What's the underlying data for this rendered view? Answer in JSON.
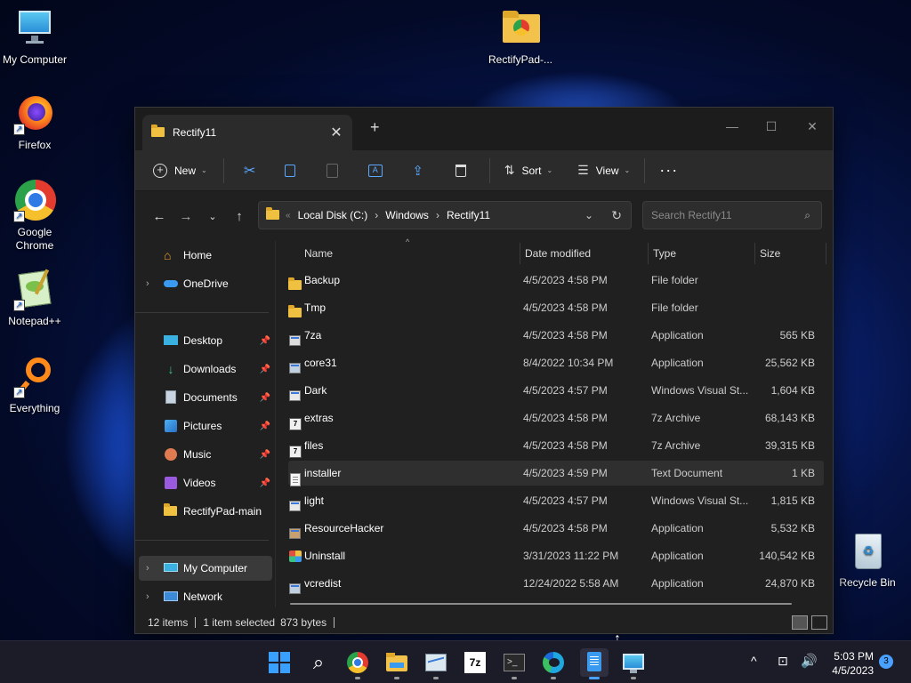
{
  "desktop": {
    "icons": [
      {
        "label": "My Computer"
      },
      {
        "label": "Firefox"
      },
      {
        "label": "Google Chrome"
      },
      {
        "label": "Notepad++"
      },
      {
        "label": "Everything"
      },
      {
        "label": "RectifyPad-..."
      },
      {
        "label": "Recycle Bin"
      }
    ]
  },
  "window": {
    "tab_title": "Rectify11",
    "toolbar": {
      "new_label": "New",
      "sort_label": "Sort",
      "view_label": "View"
    },
    "address": {
      "breadcrumb": [
        "Local Disk (C:)",
        "Windows",
        "Rectify11"
      ],
      "search_placeholder": "Search Rectify11"
    },
    "nav": {
      "items": [
        {
          "label": "Home"
        },
        {
          "label": "OneDrive"
        },
        {
          "label": "Desktop"
        },
        {
          "label": "Downloads"
        },
        {
          "label": "Documents"
        },
        {
          "label": "Pictures"
        },
        {
          "label": "Music"
        },
        {
          "label": "Videos"
        },
        {
          "label": "RectifyPad-main"
        },
        {
          "label": "My Computer"
        },
        {
          "label": "Network"
        }
      ]
    },
    "columns": [
      "Name",
      "Date modified",
      "Type",
      "Size"
    ],
    "files": [
      {
        "name": "Backup",
        "date": "4/5/2023 4:58 PM",
        "type": "File folder",
        "size": "",
        "icon": "folder-icon"
      },
      {
        "name": "Tmp",
        "date": "4/5/2023 4:58 PM",
        "type": "File folder",
        "size": "",
        "icon": "folder-icon"
      },
      {
        "name": "7za",
        "date": "4/5/2023 4:58 PM",
        "type": "Application",
        "size": "565 KB",
        "icon": "application-icon"
      },
      {
        "name": "core31",
        "date": "8/4/2022 10:34 PM",
        "type": "Application",
        "size": "25,562 KB",
        "icon": "installer-app-icon"
      },
      {
        "name": "Dark",
        "date": "4/5/2023 4:57 PM",
        "type": "Windows Visual St...",
        "size": "1,604 KB",
        "icon": "theme-file-icon"
      },
      {
        "name": "extras",
        "date": "4/5/2023 4:58 PM",
        "type": "7z Archive",
        "size": "68,143 KB",
        "icon": "7z-archive-icon"
      },
      {
        "name": "files",
        "date": "4/5/2023 4:58 PM",
        "type": "7z Archive",
        "size": "39,315 KB",
        "icon": "7z-archive-icon"
      },
      {
        "name": "installer",
        "date": "4/5/2023 4:59 PM",
        "type": "Text Document",
        "size": "1 KB",
        "icon": "text-document-icon"
      },
      {
        "name": "light",
        "date": "4/5/2023 4:57 PM",
        "type": "Windows Visual St...",
        "size": "1,815 KB",
        "icon": "theme-file-icon"
      },
      {
        "name": "ResourceHacker",
        "date": "4/5/2023 4:58 PM",
        "type": "Application",
        "size": "5,532 KB",
        "icon": "resource-hacker-icon"
      },
      {
        "name": "Uninstall",
        "date": "3/31/2023 11:22 PM",
        "type": "Application",
        "size": "140,542 KB",
        "icon": "uninstall-icon"
      },
      {
        "name": "vcredist",
        "date": "12/24/2022 5:58 AM",
        "type": "Application",
        "size": "24,870 KB",
        "icon": "installer-app-icon"
      }
    ],
    "selected_file": "installer",
    "status": {
      "items": "12 items",
      "selection": "1 item selected",
      "size": "873 bytes"
    }
  },
  "taskbar": {
    "apps": [
      "start-icon",
      "search-icon",
      "chrome-icon",
      "file-explorer-icon",
      "resource-monitor-icon",
      "7zip-icon",
      "terminal-icon",
      "edge-icon",
      "notepad-icon",
      "remote-desktop-icon"
    ],
    "time": "5:03 PM",
    "date": "4/5/2023",
    "notification_count": "3"
  }
}
